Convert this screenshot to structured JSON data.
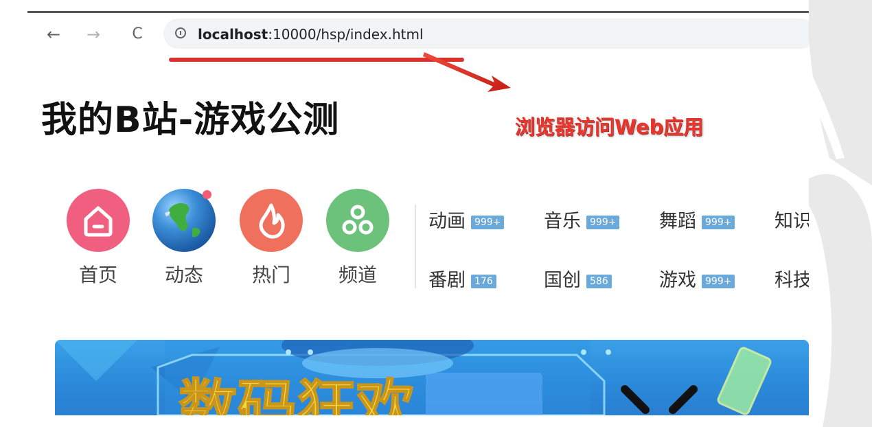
{
  "browser": {
    "url": "localhost:10000/hsp/index.html",
    "url_host": "localhost",
    "url_rest": ":10000/hsp/index.html"
  },
  "annotation": {
    "callout_text": "浏览器访问Web应用",
    "accent_color": "#e8332a"
  },
  "page": {
    "title": "我的B站-游戏公测"
  },
  "nav": [
    {
      "label": "首页",
      "icon": "home-icon"
    },
    {
      "label": "动态",
      "icon": "globe-icon"
    },
    {
      "label": "热门",
      "icon": "fire-icon"
    },
    {
      "label": "频道",
      "icon": "channel-icon"
    }
  ],
  "categories": [
    {
      "label": "动画",
      "badge": "999+"
    },
    {
      "label": "音乐",
      "badge": "999+"
    },
    {
      "label": "舞蹈",
      "badge": "999+"
    },
    {
      "label": "知识",
      "badge": ""
    },
    {
      "label": "番剧",
      "badge": "176"
    },
    {
      "label": "国创",
      "badge": "586"
    },
    {
      "label": "游戏",
      "badge": "999+"
    },
    {
      "label": "科技",
      "badge": ""
    }
  ],
  "banner": {
    "text": "数码狂欢"
  }
}
